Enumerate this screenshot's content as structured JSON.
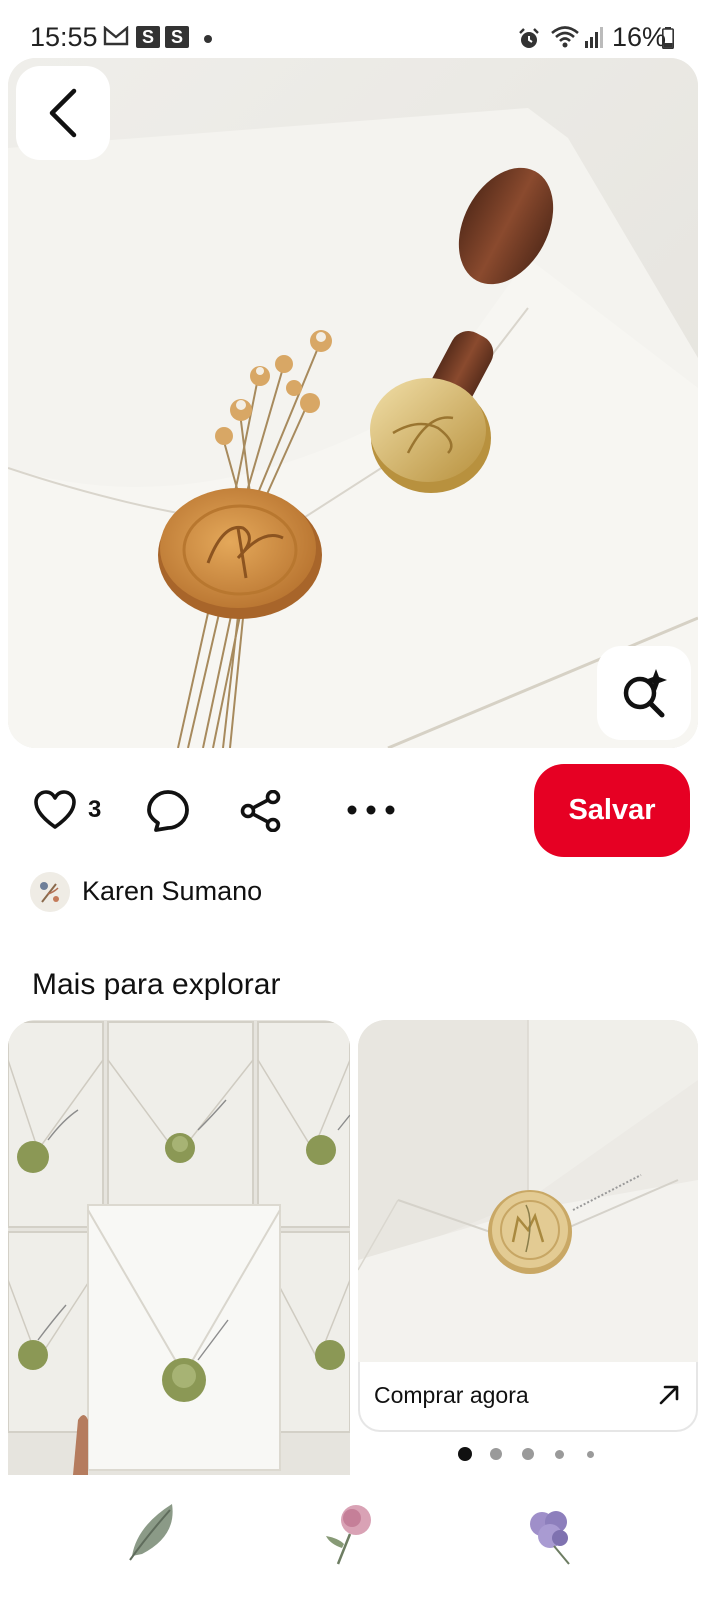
{
  "status_bar": {
    "time": "15:55",
    "s_badge_1": "S",
    "s_badge_2": "S",
    "battery": "16%"
  },
  "pin": {
    "like_count": "3",
    "save_label": "Salvar",
    "author": "Karen Sumano"
  },
  "explore": {
    "title": "Mais para explorar",
    "shop_label": "Comprar agora"
  },
  "icons": {
    "back": "chevron-left",
    "lens": "visual-search",
    "like": "heart-outline",
    "comment": "chat-bubble",
    "share": "share-nodes",
    "more": "three-dots",
    "shop_arrow": "arrow-up-right"
  },
  "colors": {
    "accent": "#e60023",
    "wax_seal": "#c98a3c",
    "sage_seal": "#8e9a5a",
    "gold_seal": "#d9bd7d"
  },
  "carousel": {
    "total": 5,
    "active_index": 0
  },
  "nav": [
    "leaf-icon",
    "rose-icon",
    "purple-flower-icon"
  ]
}
